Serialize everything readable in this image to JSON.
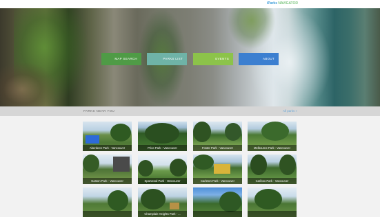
{
  "header": {
    "brand_part1": "iParks",
    "brand_part2": "NAVIGATOR"
  },
  "nav": {
    "buttons": [
      {
        "label": "MAP SEARCH",
        "color": "#4f9b46"
      },
      {
        "label": "PARKS LIST",
        "color": "#6fb3a7"
      },
      {
        "label": "EVENTS",
        "color": "#8cc34a"
      },
      {
        "label": "ABOUT",
        "color": "#3c7fd0"
      }
    ]
  },
  "section": {
    "title": "PARKS NEAR YOU",
    "all_link": "All parks »"
  },
  "parks": [
    {
      "name": "Aberdeen Park - Vancouver"
    },
    {
      "name": "Price Park - Vancouver"
    },
    {
      "name": "Foster Park - Vancouver"
    },
    {
      "name": "Melbourne Park - Vancouver"
    },
    {
      "name": "Gaston Park - Vancouver"
    },
    {
      "name": "Sparwood Park - Vancouver"
    },
    {
      "name": "Carleton Park - Vancouver"
    },
    {
      "name": "Cariboo Park - Vancouver"
    },
    {
      "name": ""
    },
    {
      "name": "Champlain Heights Park - ..."
    },
    {
      "name": ""
    },
    {
      "name": ""
    }
  ]
}
